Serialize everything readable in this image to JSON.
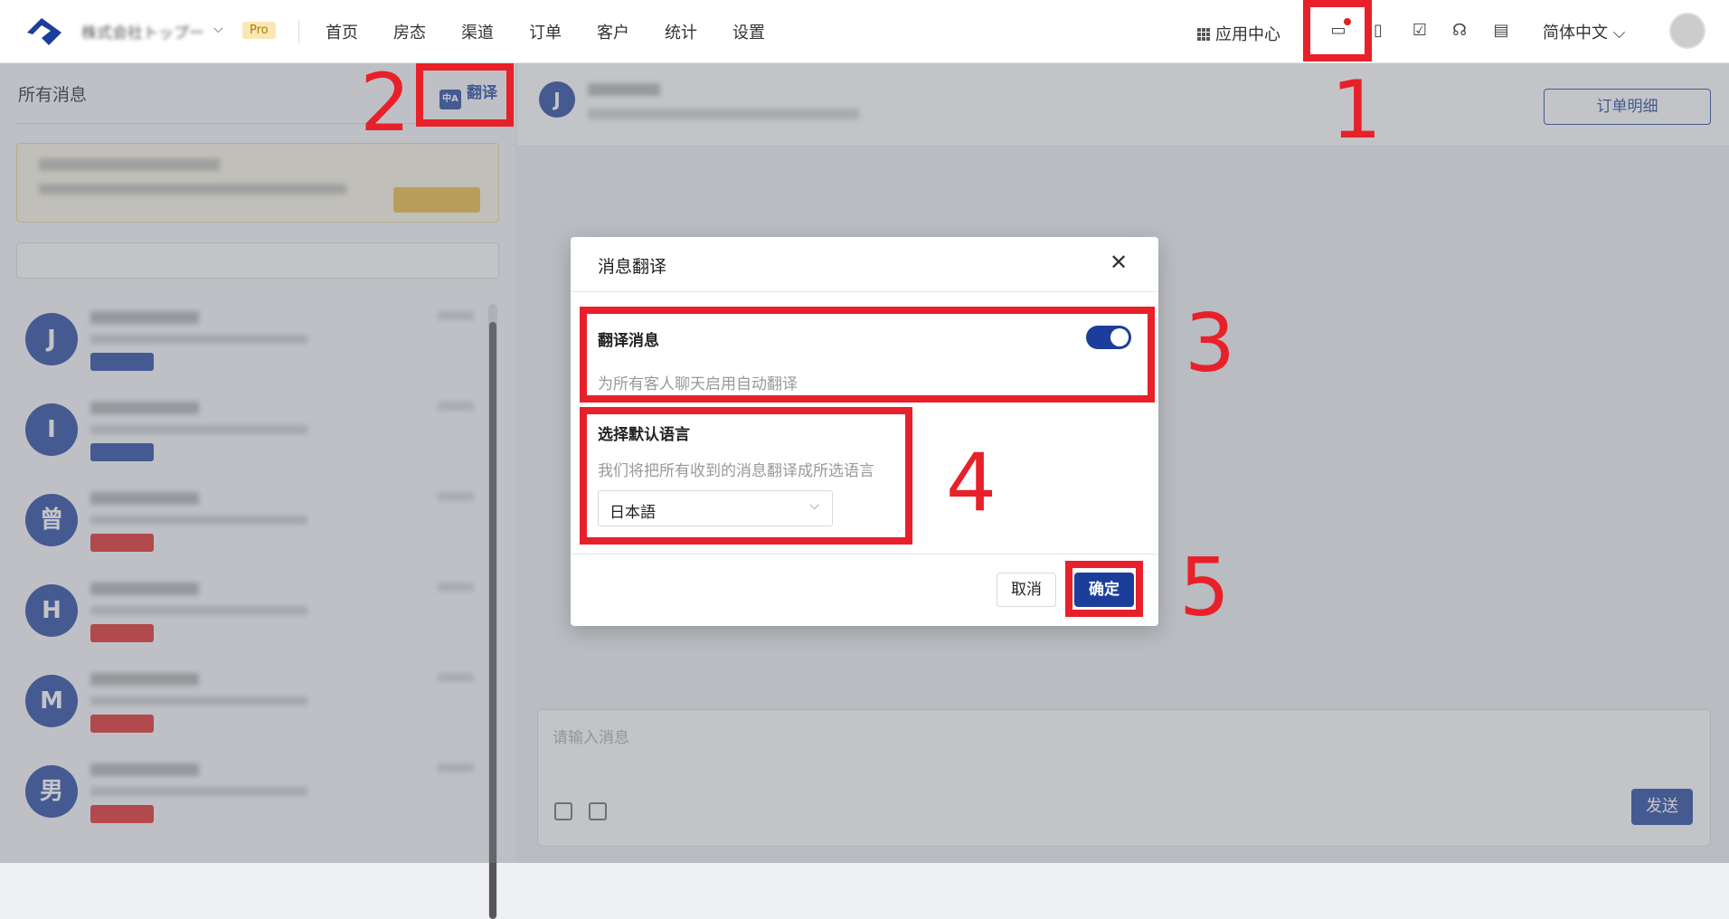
{
  "header": {
    "org_name": "株式会社トップー",
    "pro_badge": "Pro",
    "nav": [
      "首页",
      "房态",
      "渠道",
      "订单",
      "客户",
      "统计",
      "设置"
    ],
    "app_center": "应用中心",
    "language": "简体中文"
  },
  "sidebar": {
    "title": "所有消息",
    "translate_label": "翻译",
    "conversations": [
      {
        "initial": "J",
        "tag_color": "#1c3e9b"
      },
      {
        "initial": "I",
        "tag_color": "#1c3e9b"
      },
      {
        "initial": "曾",
        "tag_color": "#e02020"
      },
      {
        "initial": "H",
        "tag_color": "#e02020"
      },
      {
        "initial": "M",
        "tag_color": "#e02020"
      },
      {
        "initial": "男",
        "tag_color": "#e02020"
      }
    ]
  },
  "chat": {
    "header_initial": "J",
    "order_detail_button": "订单明细",
    "input_placeholder": "请输入消息",
    "send_label": "发送"
  },
  "modal": {
    "title": "消息翻译",
    "translate_section": {
      "label": "翻译消息",
      "description": "为所有客人聊天启用自动翻译",
      "enabled": true
    },
    "language_section": {
      "label": "选择默认语言",
      "description": "我们将把所有收到的消息翻译成所选语言",
      "selected": "日本語"
    },
    "cancel_label": "取消",
    "confirm_label": "确定"
  },
  "annotations": [
    "1",
    "2",
    "3",
    "4",
    "5"
  ],
  "colors": {
    "brand": "#1c3e9b",
    "annotation": "#e8202a"
  }
}
